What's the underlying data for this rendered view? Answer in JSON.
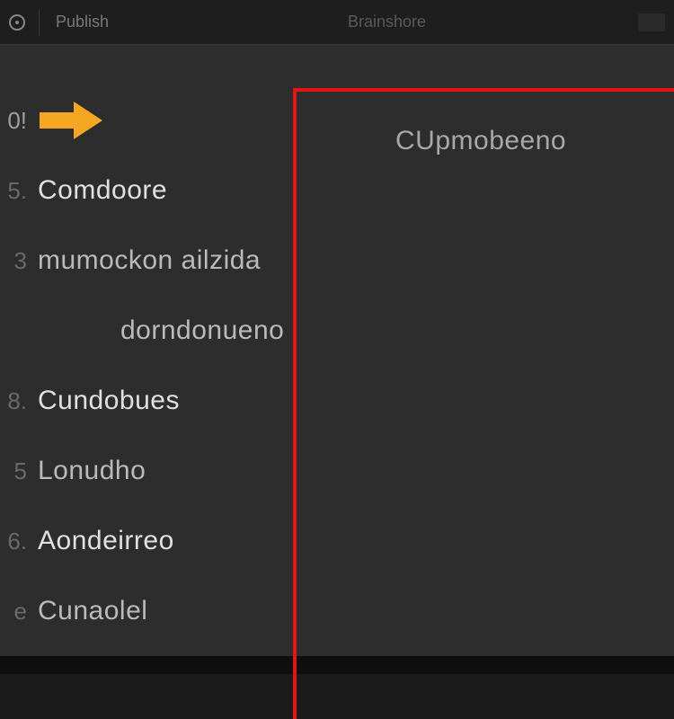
{
  "topbar": {
    "menu1": "Publish",
    "center_label": "Brainshore"
  },
  "column_heading": "CUpmobeeno",
  "rows": [
    {
      "marker": "0!",
      "text": "",
      "type": "current"
    },
    {
      "marker": "5.",
      "text": "Comdoore",
      "type": "item"
    },
    {
      "marker": "3",
      "text": "mumockon ailzida",
      "type": "item-dim"
    },
    {
      "marker": "",
      "text": "dorndonueno",
      "type": "continuation"
    },
    {
      "marker": "8.",
      "text": "Cundobues",
      "type": "item"
    },
    {
      "marker": "5",
      "text": "Lonudho",
      "type": "item-dim"
    },
    {
      "marker": "6.",
      "text": "Aondeirreo",
      "type": "item"
    },
    {
      "marker": "e",
      "text": "Cunaolel",
      "type": "item-dim"
    }
  ],
  "colors": {
    "accent": "#f5a623",
    "ruler": "#e81313"
  }
}
